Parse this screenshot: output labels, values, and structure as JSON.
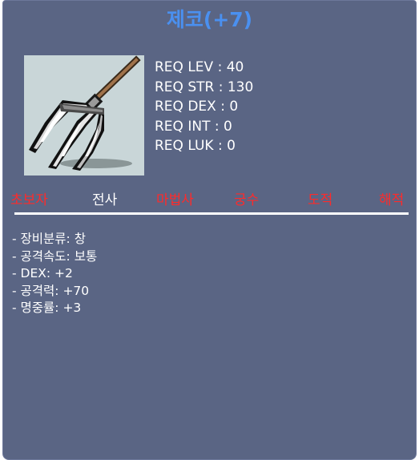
{
  "item": {
    "name": "제코(+7)",
    "name_color": "#4a90f0",
    "icon": "spear-icon"
  },
  "requirements": [
    "REQ LEV : 40",
    "REQ STR : 130",
    "REQ DEX : 0",
    "REQ INT : 0",
    "REQ LUK : 0"
  ],
  "jobs": [
    {
      "label": "초보자",
      "color": "#ff2a2a"
    },
    {
      "label": "전사",
      "color": "#ffffff"
    },
    {
      "label": "마법사",
      "color": "#ff2a2a"
    },
    {
      "label": "궁수",
      "color": "#ff2a2a"
    },
    {
      "label": "도적",
      "color": "#ff2a2a"
    },
    {
      "label": "해적",
      "color": "#ff2a2a"
    }
  ],
  "stats": [
    "- 장비분류: 창",
    "- 공격속도: 보통",
    "- DEX: +2",
    "- 공격력: +70",
    "- 명중률: +3"
  ],
  "colors": {
    "panel_bg": "#5a6584",
    "text": "#ffffff",
    "icon_bg": "#c9d6d8"
  }
}
